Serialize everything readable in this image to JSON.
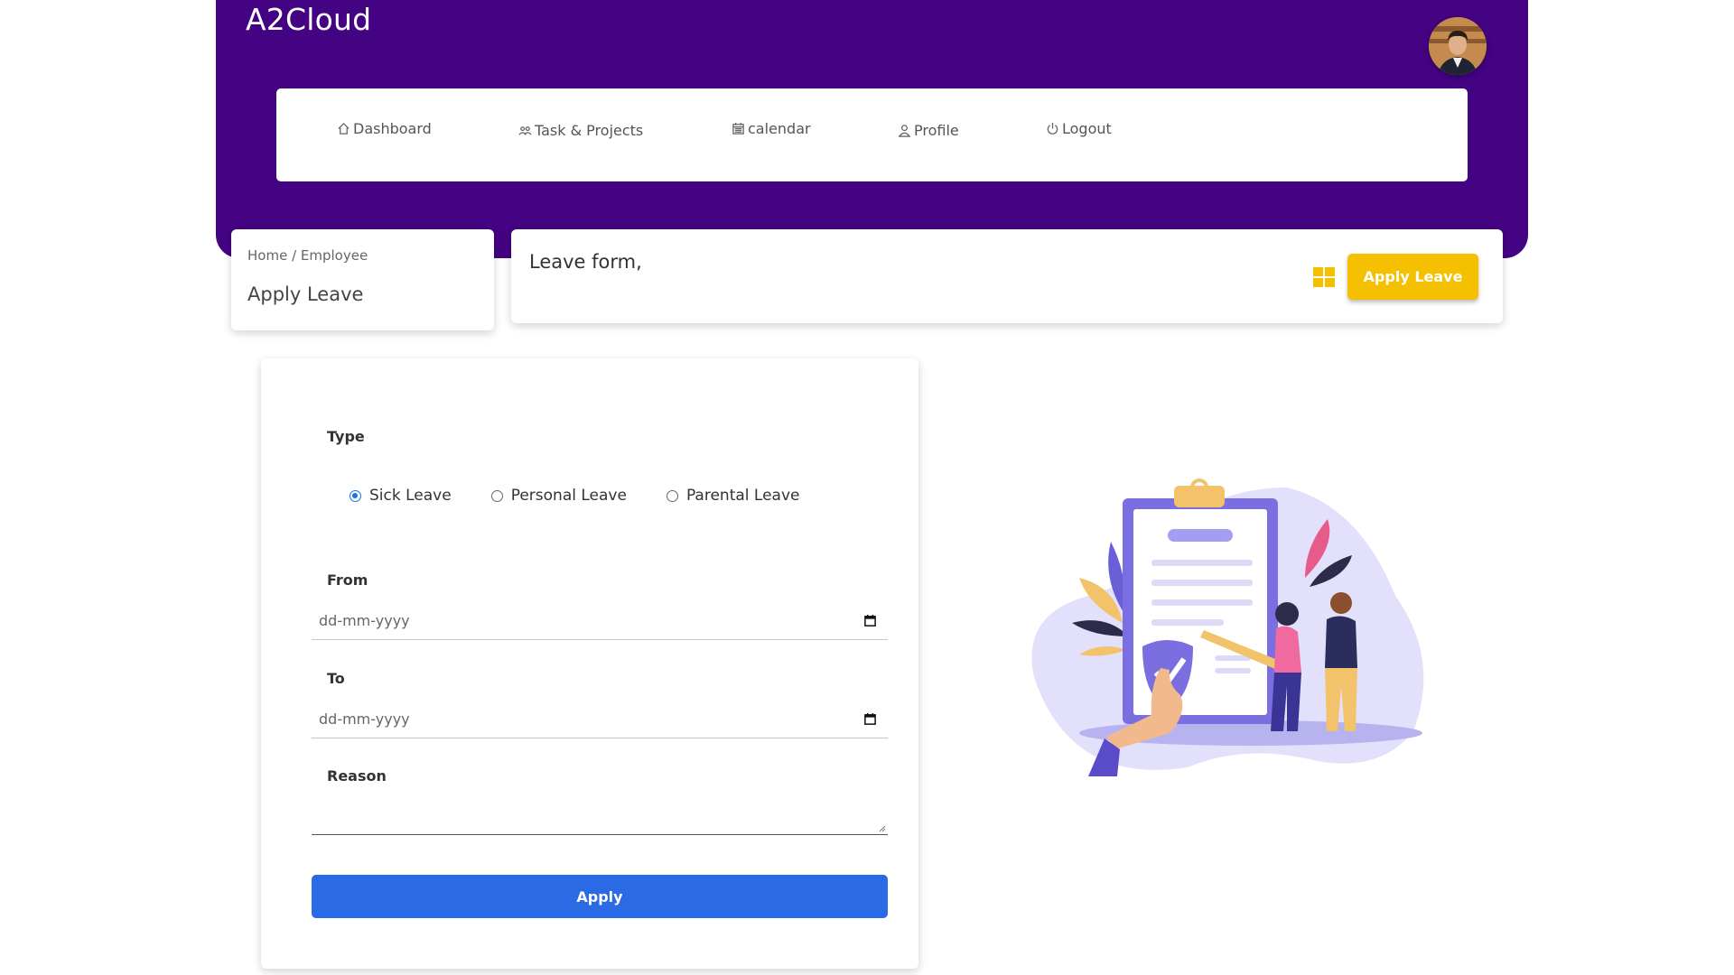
{
  "app": {
    "brand": "A2Cloud"
  },
  "nav": {
    "items": [
      {
        "label": "Dashboard",
        "icon": "home-icon"
      },
      {
        "label": "Task & Projects",
        "icon": "users-icon"
      },
      {
        "label": "calendar",
        "icon": "calendar-icon"
      },
      {
        "label": "Profile",
        "icon": "user-icon"
      },
      {
        "label": "Logout",
        "icon": "power-icon"
      }
    ]
  },
  "breadcrumb": {
    "path": "Home / Employee",
    "title": "Apply Leave"
  },
  "header_card": {
    "title": "Leave form,",
    "button": "Apply Leave",
    "icon": "grid-icon"
  },
  "form": {
    "type_label": "Type",
    "options": [
      "Sick Leave",
      "Personal Leave",
      "Parental Leave"
    ],
    "selected": "Sick Leave",
    "from_label": "From",
    "from_placeholder": "dd-mm-yyyy",
    "to_label": "To",
    "to_placeholder": "dd-mm-yyyy",
    "reason_label": "Reason",
    "submit": "Apply"
  },
  "colors": {
    "header_bg": "#440382",
    "accent_yellow": "#f4c000",
    "primary_blue": "#2b6ae5"
  }
}
